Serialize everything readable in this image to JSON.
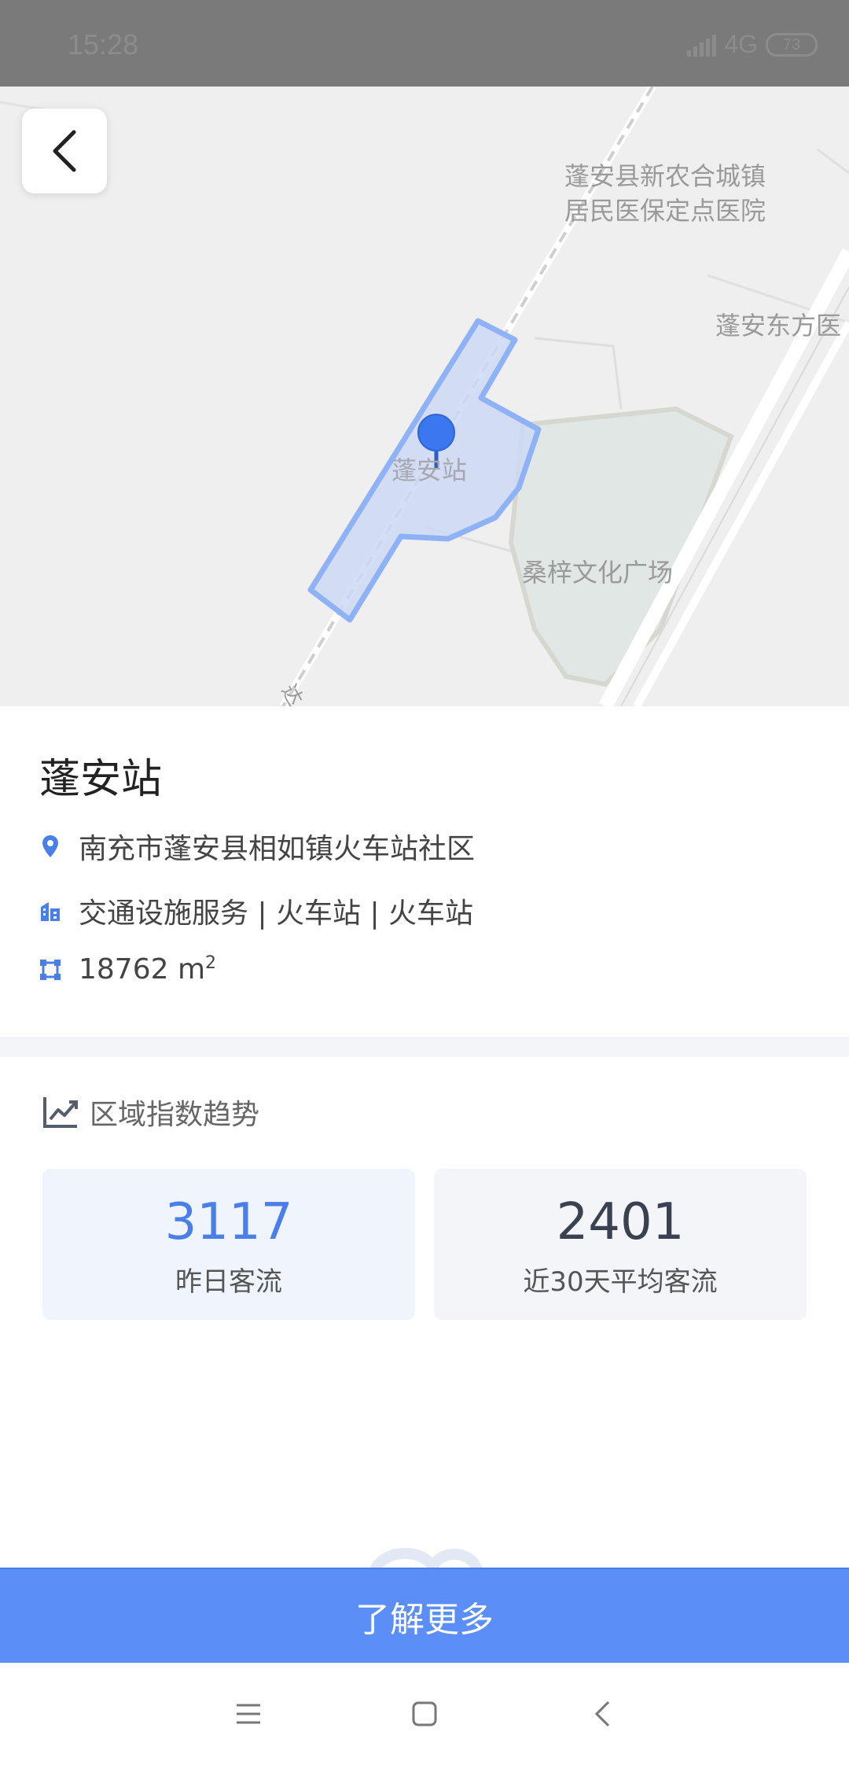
{
  "status_bar": {
    "time": "15:28",
    "network": "4G",
    "battery": "73"
  },
  "map": {
    "labels": {
      "hospital": "蓬安县新农合城镇\n居民医保定点医院",
      "east_hospital": "蓬安东方医",
      "station": "蓬安站",
      "plaza": "桑梓文化广场",
      "road_fragment": "达"
    },
    "colors": {
      "area_fill": "#cdd9f5",
      "area_stroke": "#8fb2f7",
      "pin": "#3b78f0"
    }
  },
  "place": {
    "name": "蓬安站",
    "address": "南充市蓬安县相如镇火车站社区",
    "category": "交通设施服务 | 火车站 | 火车站",
    "area_value": "18762 m",
    "area_sup": "2"
  },
  "trend": {
    "title": "区域指数趋势",
    "cards": [
      {
        "value": "3117",
        "label": "昨日客流",
        "color": "#4a7ee8"
      },
      {
        "value": "2401",
        "label": "近30天平均客流",
        "color": "#3a4150"
      }
    ]
  },
  "cta": {
    "label": "了解更多"
  },
  "icons": [
    "back-icon",
    "location-pin-icon",
    "building-icon",
    "area-icon",
    "trend-chart-icon",
    "menu-icon",
    "home-icon",
    "nav-back-icon"
  ]
}
